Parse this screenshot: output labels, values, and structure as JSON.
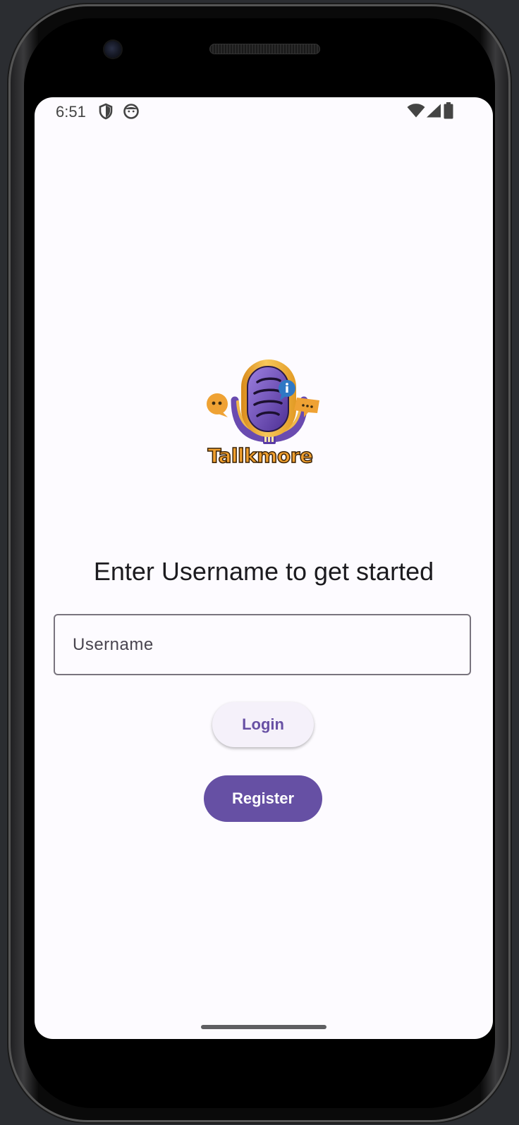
{
  "status_bar": {
    "time": "6:51",
    "left_icons": [
      "shield-icon",
      "app-face-icon"
    ],
    "right_icons": [
      "wifi-icon",
      "cellular-signal-icon",
      "battery-icon"
    ]
  },
  "logo": {
    "icon": "microphone-chat-logo-icon",
    "text": "Tallkmore"
  },
  "main": {
    "heading": "Enter Username to get started",
    "username_placeholder": "Username",
    "username_value": "",
    "login_label": "Login",
    "register_label": "Register"
  },
  "colors": {
    "primary": "#6650a4",
    "login_background": "#f5f1fa",
    "login_text": "#6750a4",
    "screen_background": "#fdfbff",
    "field_border": "#79747e",
    "logo_orange": "#f0a030",
    "logo_purple": "#6a4bb0"
  }
}
